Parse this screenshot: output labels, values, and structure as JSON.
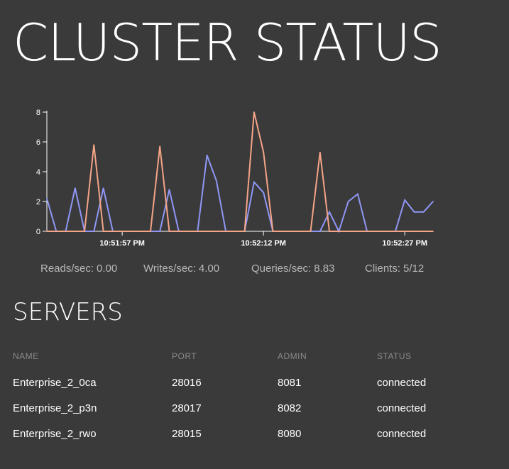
{
  "page": {
    "title": "CLUSTER STATUS"
  },
  "colors": {
    "background": "#3a3a3a",
    "reads_series": "#8f96f5",
    "writes_series": "#f4a487",
    "axis": "#ffffff",
    "muted_text": "#b8b8b8",
    "header_text": "#8a8a8a"
  },
  "chart_data": {
    "type": "line",
    "x_ticks": [
      "10:51:57 PM",
      "10:52:12 PM",
      "10:52:27 PM"
    ],
    "x_tick_index": [
      8,
      23,
      38
    ],
    "ylim": [
      0,
      8
    ],
    "y_ticks": [
      0,
      2,
      4,
      6,
      8
    ],
    "grid": false,
    "series": [
      {
        "key": "reads",
        "color": "#8f96f5",
        "values": [
          2.2,
          0,
          0,
          2.9,
          0,
          0,
          2.9,
          0,
          0,
          0,
          0,
          0,
          0,
          2.8,
          0,
          0,
          0,
          5.1,
          3.4,
          0,
          0,
          0,
          3.3,
          2.6,
          0,
          0,
          0,
          0,
          0,
          0,
          1.3,
          0,
          2.0,
          2.5,
          0,
          0,
          0,
          0,
          2.1,
          1.3,
          1.3,
          2.0
        ]
      },
      {
        "key": "writes",
        "color": "#f4a487",
        "values": [
          0,
          0,
          0,
          0,
          0,
          5.8,
          0,
          0,
          0,
          0,
          0,
          0,
          5.7,
          0,
          0,
          0,
          0,
          0,
          0,
          0,
          0,
          0,
          8.0,
          5.3,
          0,
          0,
          0,
          0,
          0,
          5.3,
          0,
          0,
          0,
          0,
          0,
          0,
          0,
          0,
          0,
          0,
          0,
          0
        ]
      }
    ]
  },
  "stats": {
    "reads": {
      "label": "Reads/sec:",
      "value": "0.00"
    },
    "writes": {
      "label": "Writes/sec:",
      "value": "4.00"
    },
    "queries": {
      "label": "Queries/sec:",
      "value": "8.83"
    },
    "clients": {
      "label": "Clients:",
      "value": "5/12"
    }
  },
  "servers": {
    "title": "SERVERS",
    "columns": [
      "NAME",
      "PORT",
      "ADMIN",
      "STATUS"
    ],
    "rows": [
      {
        "name": "Enterprise_2_0ca",
        "port": "28016",
        "admin": "8081",
        "status": "connected"
      },
      {
        "name": "Enterprise_2_p3n",
        "port": "28017",
        "admin": "8082",
        "status": "connected"
      },
      {
        "name": "Enterprise_2_rwo",
        "port": "28015",
        "admin": "8080",
        "status": "connected"
      }
    ]
  }
}
